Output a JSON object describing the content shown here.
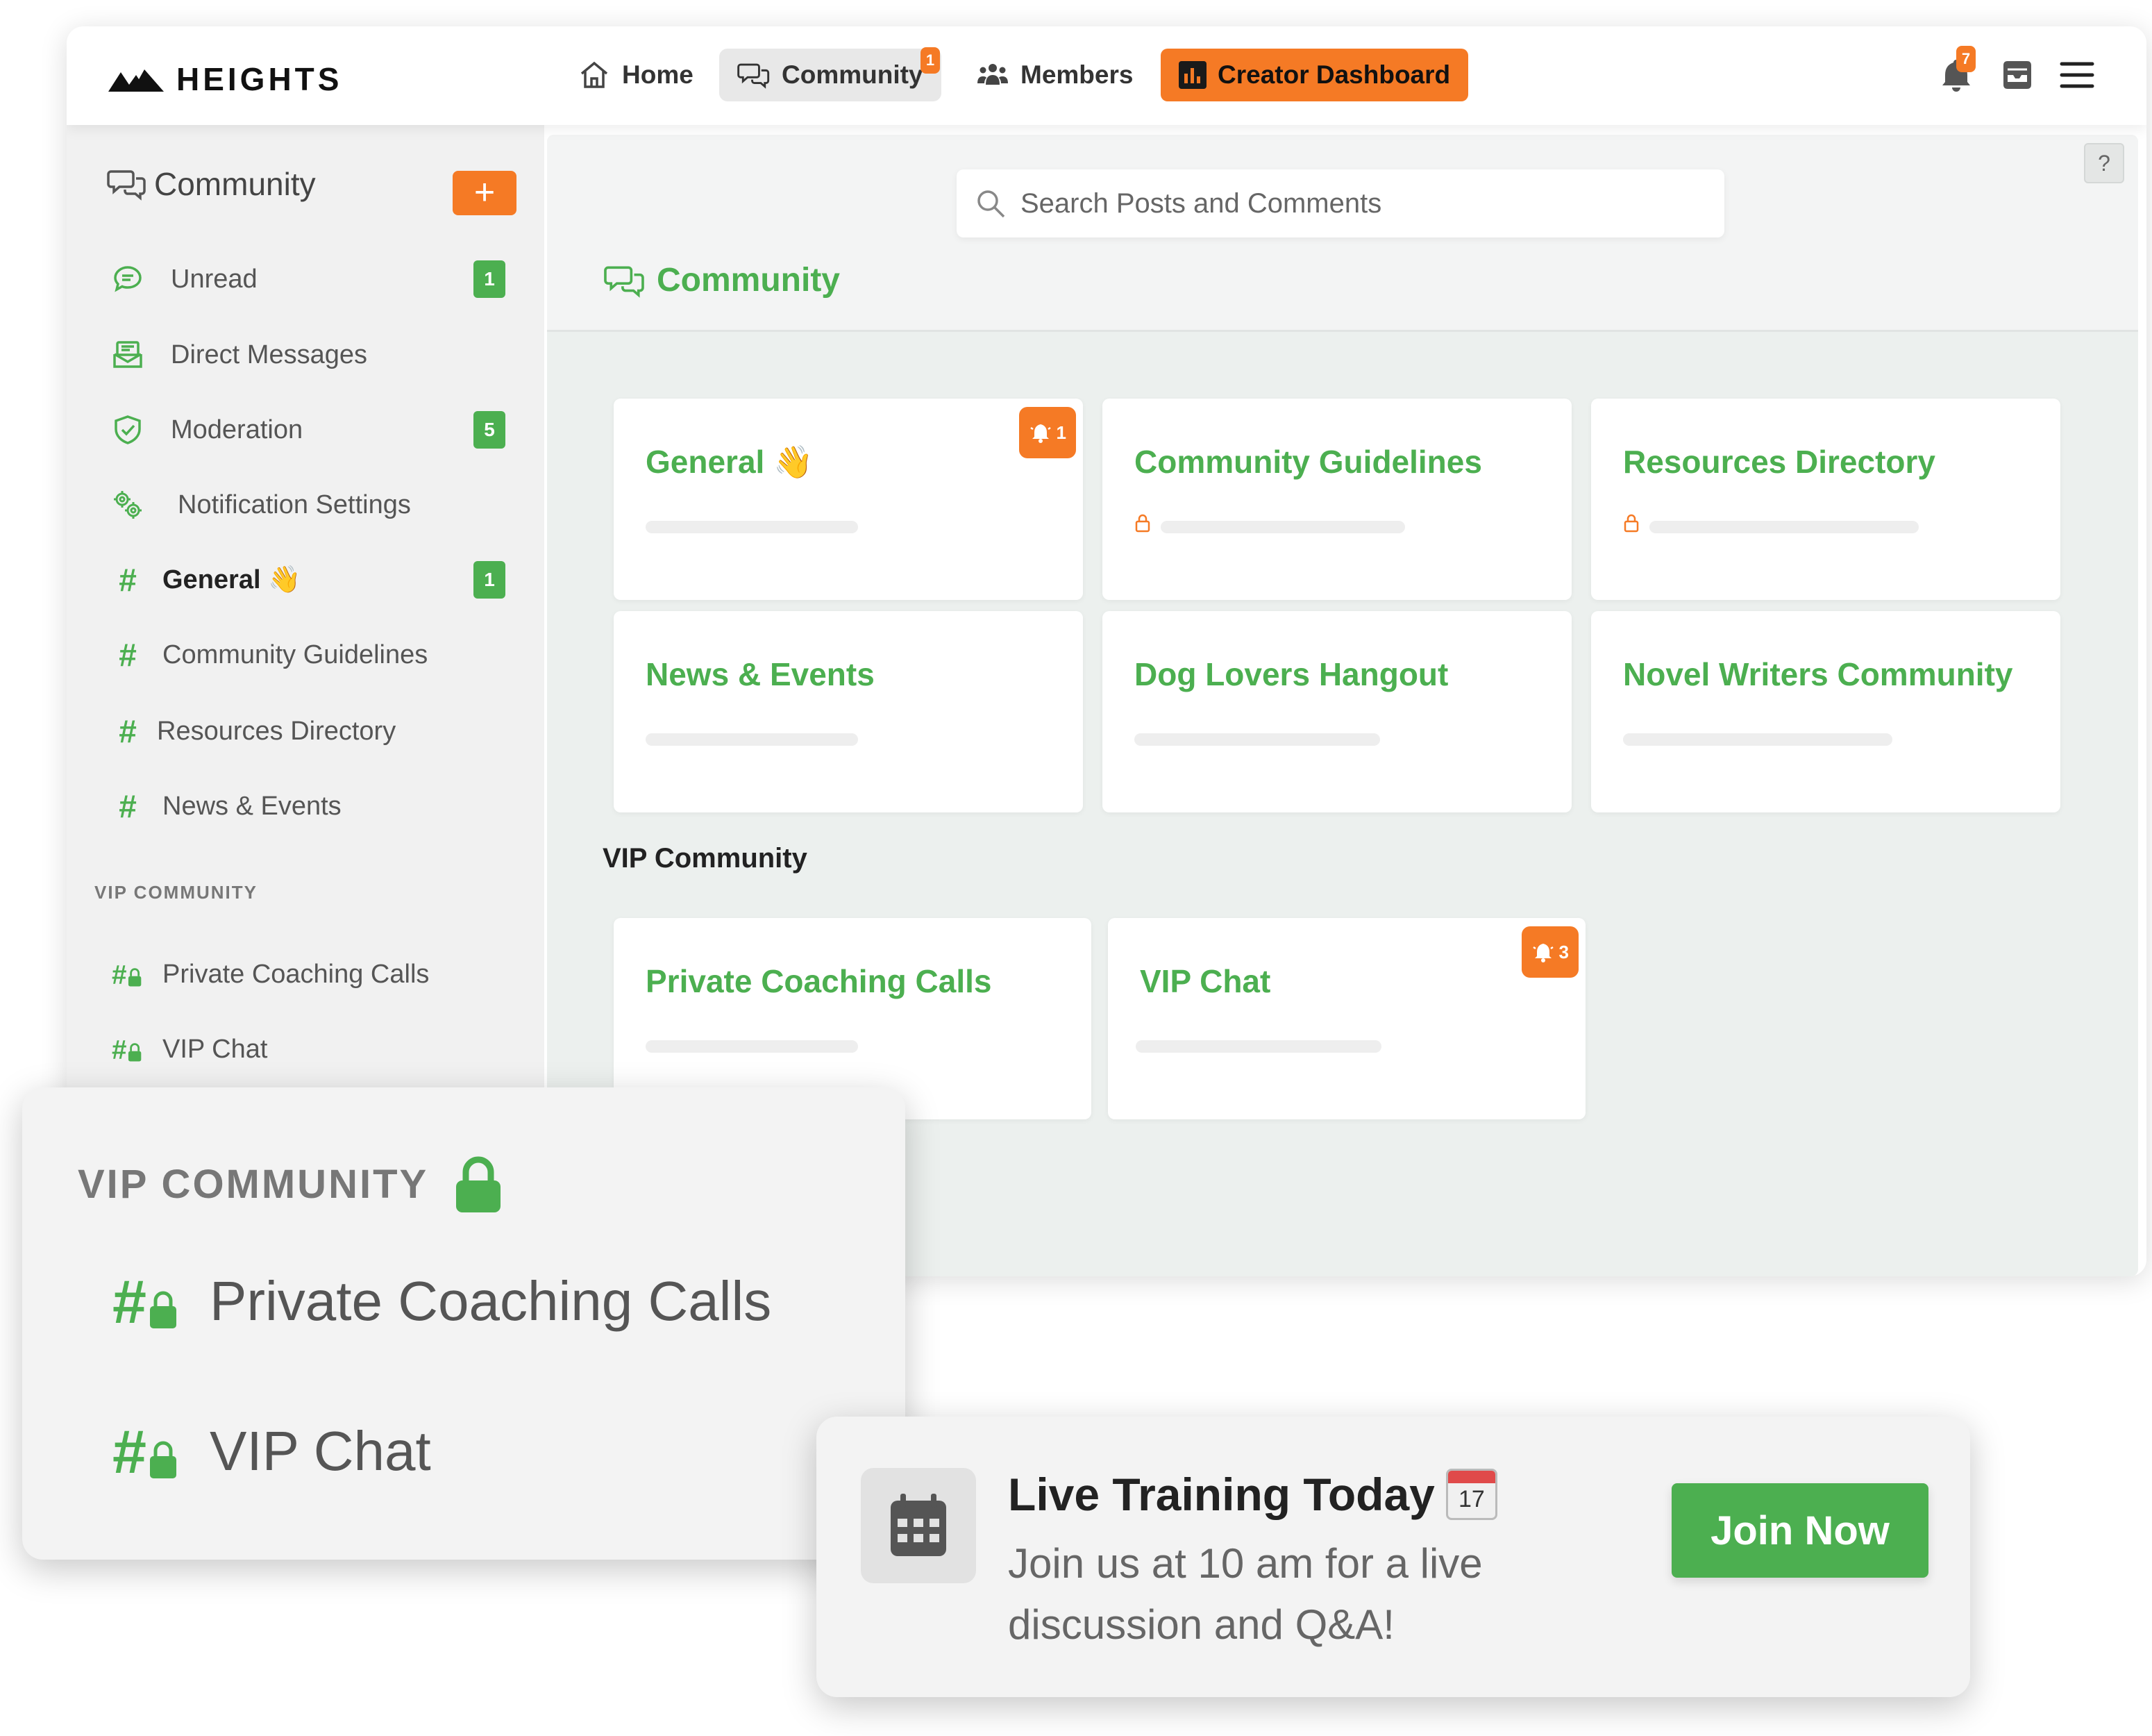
{
  "brand": {
    "name": "HEIGHTS"
  },
  "nav": {
    "home": "Home",
    "community": "Community",
    "community_badge": "1",
    "members": "Members",
    "creator": "Creator Dashboard",
    "notifications_badge": "7",
    "icons": [
      "home-icon",
      "chat-icon",
      "members-icon",
      "chart-icon",
      "bell-icon",
      "inbox-icon",
      "menu-icon"
    ]
  },
  "sidebar": {
    "title": "Community",
    "add_label": "+",
    "items": [
      {
        "label": "Unread",
        "icon": "chat-bubble-icon",
        "badge": "1"
      },
      {
        "label": "Direct Messages",
        "icon": "message-icon",
        "badge": ""
      },
      {
        "label": "Moderation",
        "icon": "shield-icon",
        "badge": "5"
      },
      {
        "label": "Notification Settings",
        "icon": "gears-icon",
        "badge": ""
      },
      {
        "label": "General 👋",
        "icon": "hash-icon",
        "badge": "1"
      },
      {
        "label": "Community Guidelines",
        "icon": "hash-icon",
        "badge": ""
      },
      {
        "label": "Resources Directory",
        "icon": "hash-icon",
        "badge": ""
      },
      {
        "label": "News & Events",
        "icon": "hash-icon",
        "badge": ""
      }
    ],
    "section": "VIP COMMUNITY",
    "vip_items": [
      {
        "label": "Private Coaching Calls",
        "icon": "hash-lock-icon"
      },
      {
        "label": "VIP Chat",
        "icon": "hash-lock-icon"
      }
    ]
  },
  "main": {
    "search_placeholder": "Search Posts and Comments",
    "help": "?",
    "title": "Community",
    "cards": [
      {
        "title": "General 👋",
        "locked": false,
        "bell": "1"
      },
      {
        "title": "Community Guidelines",
        "locked": true,
        "bell": ""
      },
      {
        "title": "Resources Directory",
        "locked": true,
        "bell": ""
      },
      {
        "title": "News & Events",
        "locked": false,
        "bell": ""
      },
      {
        "title": "Dog Lovers Hangout",
        "locked": false,
        "bell": ""
      },
      {
        "title": "Novel Writers Community",
        "locked": false,
        "bell": ""
      }
    ],
    "vip_section": "VIP Community",
    "vip_cards": [
      {
        "title": "Private Coaching Calls",
        "bell": ""
      },
      {
        "title": "VIP Chat",
        "bell": "3"
      }
    ]
  },
  "vip_overlay": {
    "title": "VIP COMMUNITY",
    "items": [
      "Private Coaching Calls",
      "VIP Chat"
    ]
  },
  "training": {
    "title": "Live Training Today",
    "cal_day": "17",
    "body": "Join us at 10 am for a live discussion and Q&A!",
    "button": "Join Now"
  },
  "colors": {
    "accent_green": "#4caf50",
    "accent_orange": "#f57a25"
  }
}
